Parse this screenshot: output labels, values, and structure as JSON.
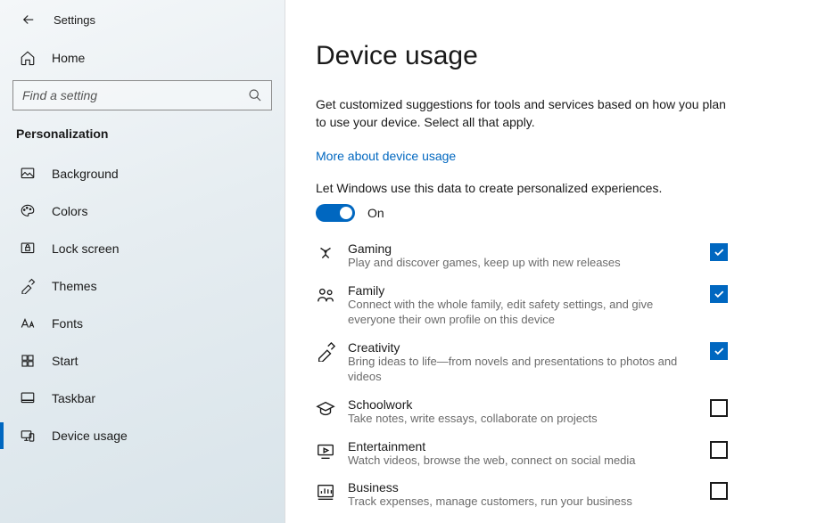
{
  "window_title": "Settings",
  "home_label": "Home",
  "search": {
    "placeholder": "Find a setting"
  },
  "category": "Personalization",
  "sidebar_items": [
    {
      "label": "Background",
      "icon": "background-icon"
    },
    {
      "label": "Colors",
      "icon": "colors-icon"
    },
    {
      "label": "Lock screen",
      "icon": "lockscreen-icon"
    },
    {
      "label": "Themes",
      "icon": "themes-icon"
    },
    {
      "label": "Fonts",
      "icon": "fonts-icon"
    },
    {
      "label": "Start",
      "icon": "start-icon"
    },
    {
      "label": "Taskbar",
      "icon": "taskbar-icon"
    },
    {
      "label": "Device usage",
      "icon": "deviceusage-icon",
      "active": true
    }
  ],
  "main": {
    "title": "Device usage",
    "description": "Get customized suggestions for tools and services based on how you plan to use your device. Select all that apply.",
    "link": "More about device usage",
    "subtext": "Let Windows use this data to create personalized experiences.",
    "toggle": {
      "on": true,
      "label": "On"
    },
    "items": [
      {
        "title": "Gaming",
        "desc": "Play and discover games, keep up with new releases",
        "checked": true,
        "icon": "gaming-icon"
      },
      {
        "title": "Family",
        "desc": "Connect with the whole family, edit safety settings, and give everyone their own profile on this device",
        "checked": true,
        "icon": "family-icon"
      },
      {
        "title": "Creativity",
        "desc": "Bring ideas to life—from novels and presentations to photos and videos",
        "checked": true,
        "icon": "creativity-icon"
      },
      {
        "title": "Schoolwork",
        "desc": "Take notes, write essays, collaborate on projects",
        "checked": false,
        "icon": "schoolwork-icon"
      },
      {
        "title": "Entertainment",
        "desc": "Watch videos, browse the web, connect on social media",
        "checked": false,
        "icon": "entertainment-icon"
      },
      {
        "title": "Business",
        "desc": "Track expenses, manage customers, run your business",
        "checked": false,
        "icon": "business-icon"
      }
    ]
  }
}
